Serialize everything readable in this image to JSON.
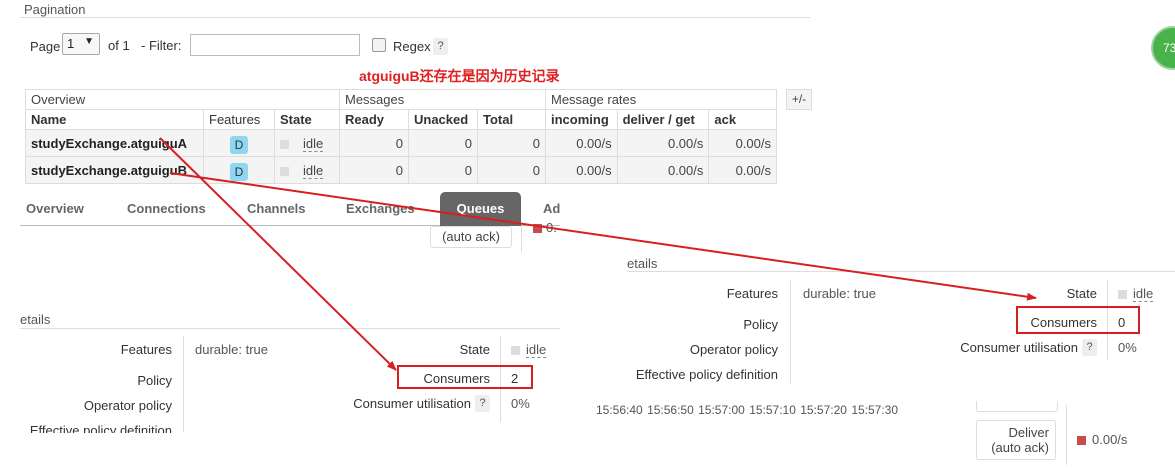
{
  "pagination": {
    "title": "Pagination",
    "page_label": "Page",
    "page_value": "1",
    "of_label": "of 1",
    "filter_label": "- Filter:",
    "filter_value": "",
    "regex_label": "Regex",
    "help_label": "?"
  },
  "annotation": "atguiguB还存在是因为历史记录",
  "gauge_text": "73",
  "table": {
    "group_headers": [
      "Overview",
      "Messages",
      "Message rates"
    ],
    "plusminus": "+/-",
    "columns": [
      "Name",
      "Features",
      "State",
      "Ready",
      "Unacked",
      "Total",
      "incoming",
      "deliver / get",
      "ack"
    ],
    "rows": [
      {
        "name": "studyExchange.atguiguA",
        "feature": "D",
        "state": "idle",
        "ready": "0",
        "unacked": "0",
        "total": "0",
        "incoming": "0.00/s",
        "deliver": "0.00/s",
        "ack": "0.00/s"
      },
      {
        "name": "studyExchange.atguiguB",
        "feature": "D",
        "state": "idle",
        "ready": "0",
        "unacked": "0",
        "total": "0",
        "incoming": "0.00/s",
        "deliver": "0.00/s",
        "ack": "0.00/s"
      }
    ]
  },
  "tabs": [
    "Overview",
    "Connections",
    "Channels",
    "Exchanges",
    "Queues",
    "Ad"
  ],
  "auto_ack": "(auto ack)",
  "rate_partial": "0.",
  "details_left": {
    "title": "etails",
    "features_label": "Features",
    "features_value": "durable: true",
    "policy_label": "Policy",
    "operator_policy_label": "Operator policy",
    "effective_policy_label": "Effective policy definition",
    "state_label": "State",
    "state_value": "idle",
    "consumers_label": "Consumers",
    "consumers_value": "2",
    "consumer_util_label": "Consumer utilisation",
    "consumer_util_value": "0%"
  },
  "details_right": {
    "title": "etails",
    "features_label": "Features",
    "features_value": "durable: true",
    "policy_label": "Policy",
    "operator_policy_label": "Operator policy",
    "effective_policy_label": "Effective policy definition",
    "state_label": "State",
    "state_value": "idle",
    "consumers_label": "Consumers",
    "consumers_value": "0",
    "consumer_util_label": "Consumer utilisation",
    "consumer_util_value": "0%",
    "times": [
      "15:56:40",
      "15:56:50",
      "15:57:00",
      "15:57:10",
      "15:57:20",
      "15:57:30"
    ],
    "deliver_label": "Deliver",
    "deliver_sub": "(auto ack)",
    "deliver_rate": "0.00/s"
  },
  "colors": {
    "annotation": "#e02020",
    "redbox": "#d62020",
    "tab_active": "#666666",
    "feature_badge": "#8fd6f2"
  }
}
